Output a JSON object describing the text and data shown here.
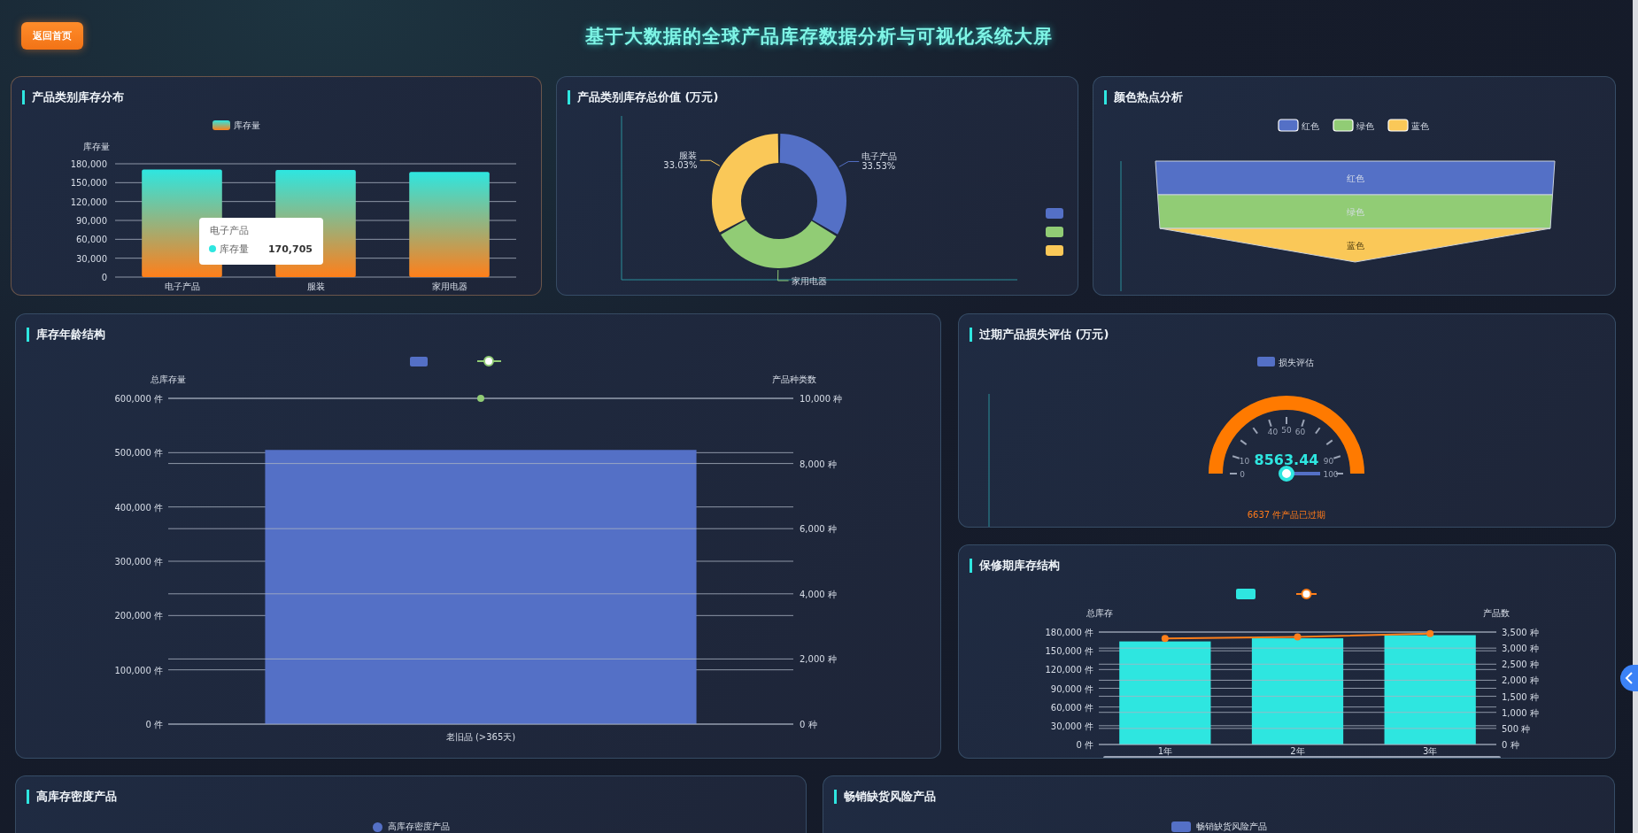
{
  "header": {
    "back_button": "返回首页",
    "title": "基于大数据的全球产品库存数据分析与可视化系统大屏"
  },
  "category_stock": {
    "title": "产品类别库存分布",
    "chart_data": {
      "type": "bar",
      "ylabel": "库存量",
      "categories": [
        "电子产品",
        "服装",
        "家用电器"
      ],
      "series": [
        {
          "name": "库存量",
          "values": [
            170705,
            170000,
            167000
          ]
        }
      ],
      "ylim": [
        0,
        180000
      ],
      "grid": true,
      "yticks": [
        {
          "value": 0,
          "label": "0"
        },
        {
          "value": 30000,
          "label": "30,000"
        },
        {
          "value": 60000,
          "label": "60,000"
        },
        {
          "value": 90000,
          "label": "90,000"
        },
        {
          "value": 120000,
          "label": "120,000"
        },
        {
          "value": 150000,
          "label": "150,000"
        },
        {
          "value": 180000,
          "label": "180,000"
        }
      ]
    },
    "tooltip": {
      "title": "电子产品",
      "series": "库存量",
      "value": "170,705"
    }
  },
  "category_value": {
    "title": "产品类别库存总价值 (万元)",
    "chart_data": {
      "type": "donut",
      "categories": [
        "电子产品",
        "家用电器",
        "服装"
      ],
      "colors": [
        "#5470c6",
        "#91cc75",
        "#fac858"
      ],
      "values": [
        33.53,
        33.44,
        33.03
      ],
      "value_labels": [
        "33.53%",
        null,
        "33.03%"
      ]
    }
  },
  "color_heat": {
    "title": "颜色热点分析",
    "legend": [
      {
        "label": "红色",
        "color": "#5470c6"
      },
      {
        "label": "绿色",
        "color": "#91cc75"
      },
      {
        "label": "蓝色",
        "color": "#fac858"
      }
    ],
    "layers": [
      {
        "label": "红色",
        "color": "#5470c6"
      },
      {
        "label": "绿色",
        "color": "#91cc75"
      },
      {
        "label": "蓝色",
        "color": "#fac858"
      }
    ]
  },
  "stock_age": {
    "title": "库存年龄结构",
    "chart_data": {
      "type": "bar",
      "categories": [
        "老旧品 (>365天)"
      ],
      "ylabel": "总库存量",
      "grid": true,
      "series": [
        {
          "color": "#5470c6",
          "values": [
            505000
          ]
        }
      ],
      "ylim": [
        0,
        600000
      ],
      "yticks": [
        {
          "value": 0,
          "label": "0 件"
        },
        {
          "value": 100000,
          "label": "100,000 件"
        },
        {
          "value": 200000,
          "label": "200,000 件"
        },
        {
          "value": 300000,
          "label": "300,000 件"
        },
        {
          "value": 400000,
          "label": "400,000 件"
        },
        {
          "value": 500000,
          "label": "500,000 件"
        },
        {
          "value": 600000,
          "label": "600,000 件"
        }
      ]
    },
    "count_line": {
      "chart_data": {
        "type": "line",
        "ylabel": "产品种类数",
        "grid": true,
        "series": [
          {
            "color": "#91cc75",
            "marker": "circle",
            "values": [
              10000
            ]
          }
        ],
        "ylim": [
          0,
          10000
        ],
        "yticks": [
          {
            "value": 0,
            "label": "0 种"
          },
          {
            "value": 2000,
            "label": "2,000 种"
          },
          {
            "value": 4000,
            "label": "4,000 种"
          },
          {
            "value": 6000,
            "label": "6,000 种"
          },
          {
            "value": 8000,
            "label": "8,000 种"
          },
          {
            "value": 10000,
            "label": "10,000 种"
          }
        ]
      }
    }
  },
  "expiry_loss": {
    "title": "过期产品损失评估 (万元)",
    "legend": "损失评估",
    "gauge": {
      "value": "8563.44",
      "level": 1,
      "scale_labels": [
        "0",
        "10",
        "40",
        "50",
        "60",
        "90",
        "100"
      ],
      "note": "6637 件产品已过期"
    }
  },
  "warranty_stock": {
    "title": "保修期库存结构",
    "chart_data": {
      "type": "bar",
      "categories": [
        "1年",
        "2年",
        "3年"
      ],
      "ylabel": "总库存",
      "grid": true,
      "series": [
        {
          "color": "#2ee6e0",
          "values": [
            165000,
            170000,
            175000
          ]
        }
      ],
      "ylim": [
        0,
        180000
      ],
      "yticks": [
        {
          "value": 0,
          "label": "0 件"
        },
        {
          "value": 30000,
          "label": "30,000 件"
        },
        {
          "value": 60000,
          "label": "60,000 件"
        },
        {
          "value": 90000,
          "label": "90,000 件"
        },
        {
          "value": 120000,
          "label": "120,000 件"
        },
        {
          "value": 150000,
          "label": "150,000 件"
        },
        {
          "value": 180000,
          "label": "180,000 件"
        }
      ]
    },
    "count_line": {
      "chart_data": {
        "type": "line",
        "ylabel": "产品数",
        "grid": true,
        "series": [
          {
            "color": "#ff7f1a",
            "marker": "circle",
            "values": [
              3300,
              3350,
              3450
            ]
          }
        ],
        "ylim": [
          0,
          3500
        ],
        "yticks": [
          {
            "value": 0,
            "label": "0 种"
          },
          {
            "value": 500,
            "label": "500 种"
          },
          {
            "value": 1000,
            "label": "1,000 种"
          },
          {
            "value": 1500,
            "label": "1,500 种"
          },
          {
            "value": 2000,
            "label": "2,000 种"
          },
          {
            "value": 2500,
            "label": "2,500 种"
          },
          {
            "value": 3000,
            "label": "3,000 种"
          },
          {
            "value": 3500,
            "label": "3,500 种"
          }
        ]
      }
    }
  },
  "high_density": {
    "title": "高库存密度产品",
    "legend": {
      "label": "高库存密度产品",
      "kind": "circle"
    }
  },
  "bestseller_risk": {
    "title": "畅销缺货风险产品",
    "legend": {
      "label": "畅销缺货风险产品",
      "kind": "rect"
    }
  }
}
